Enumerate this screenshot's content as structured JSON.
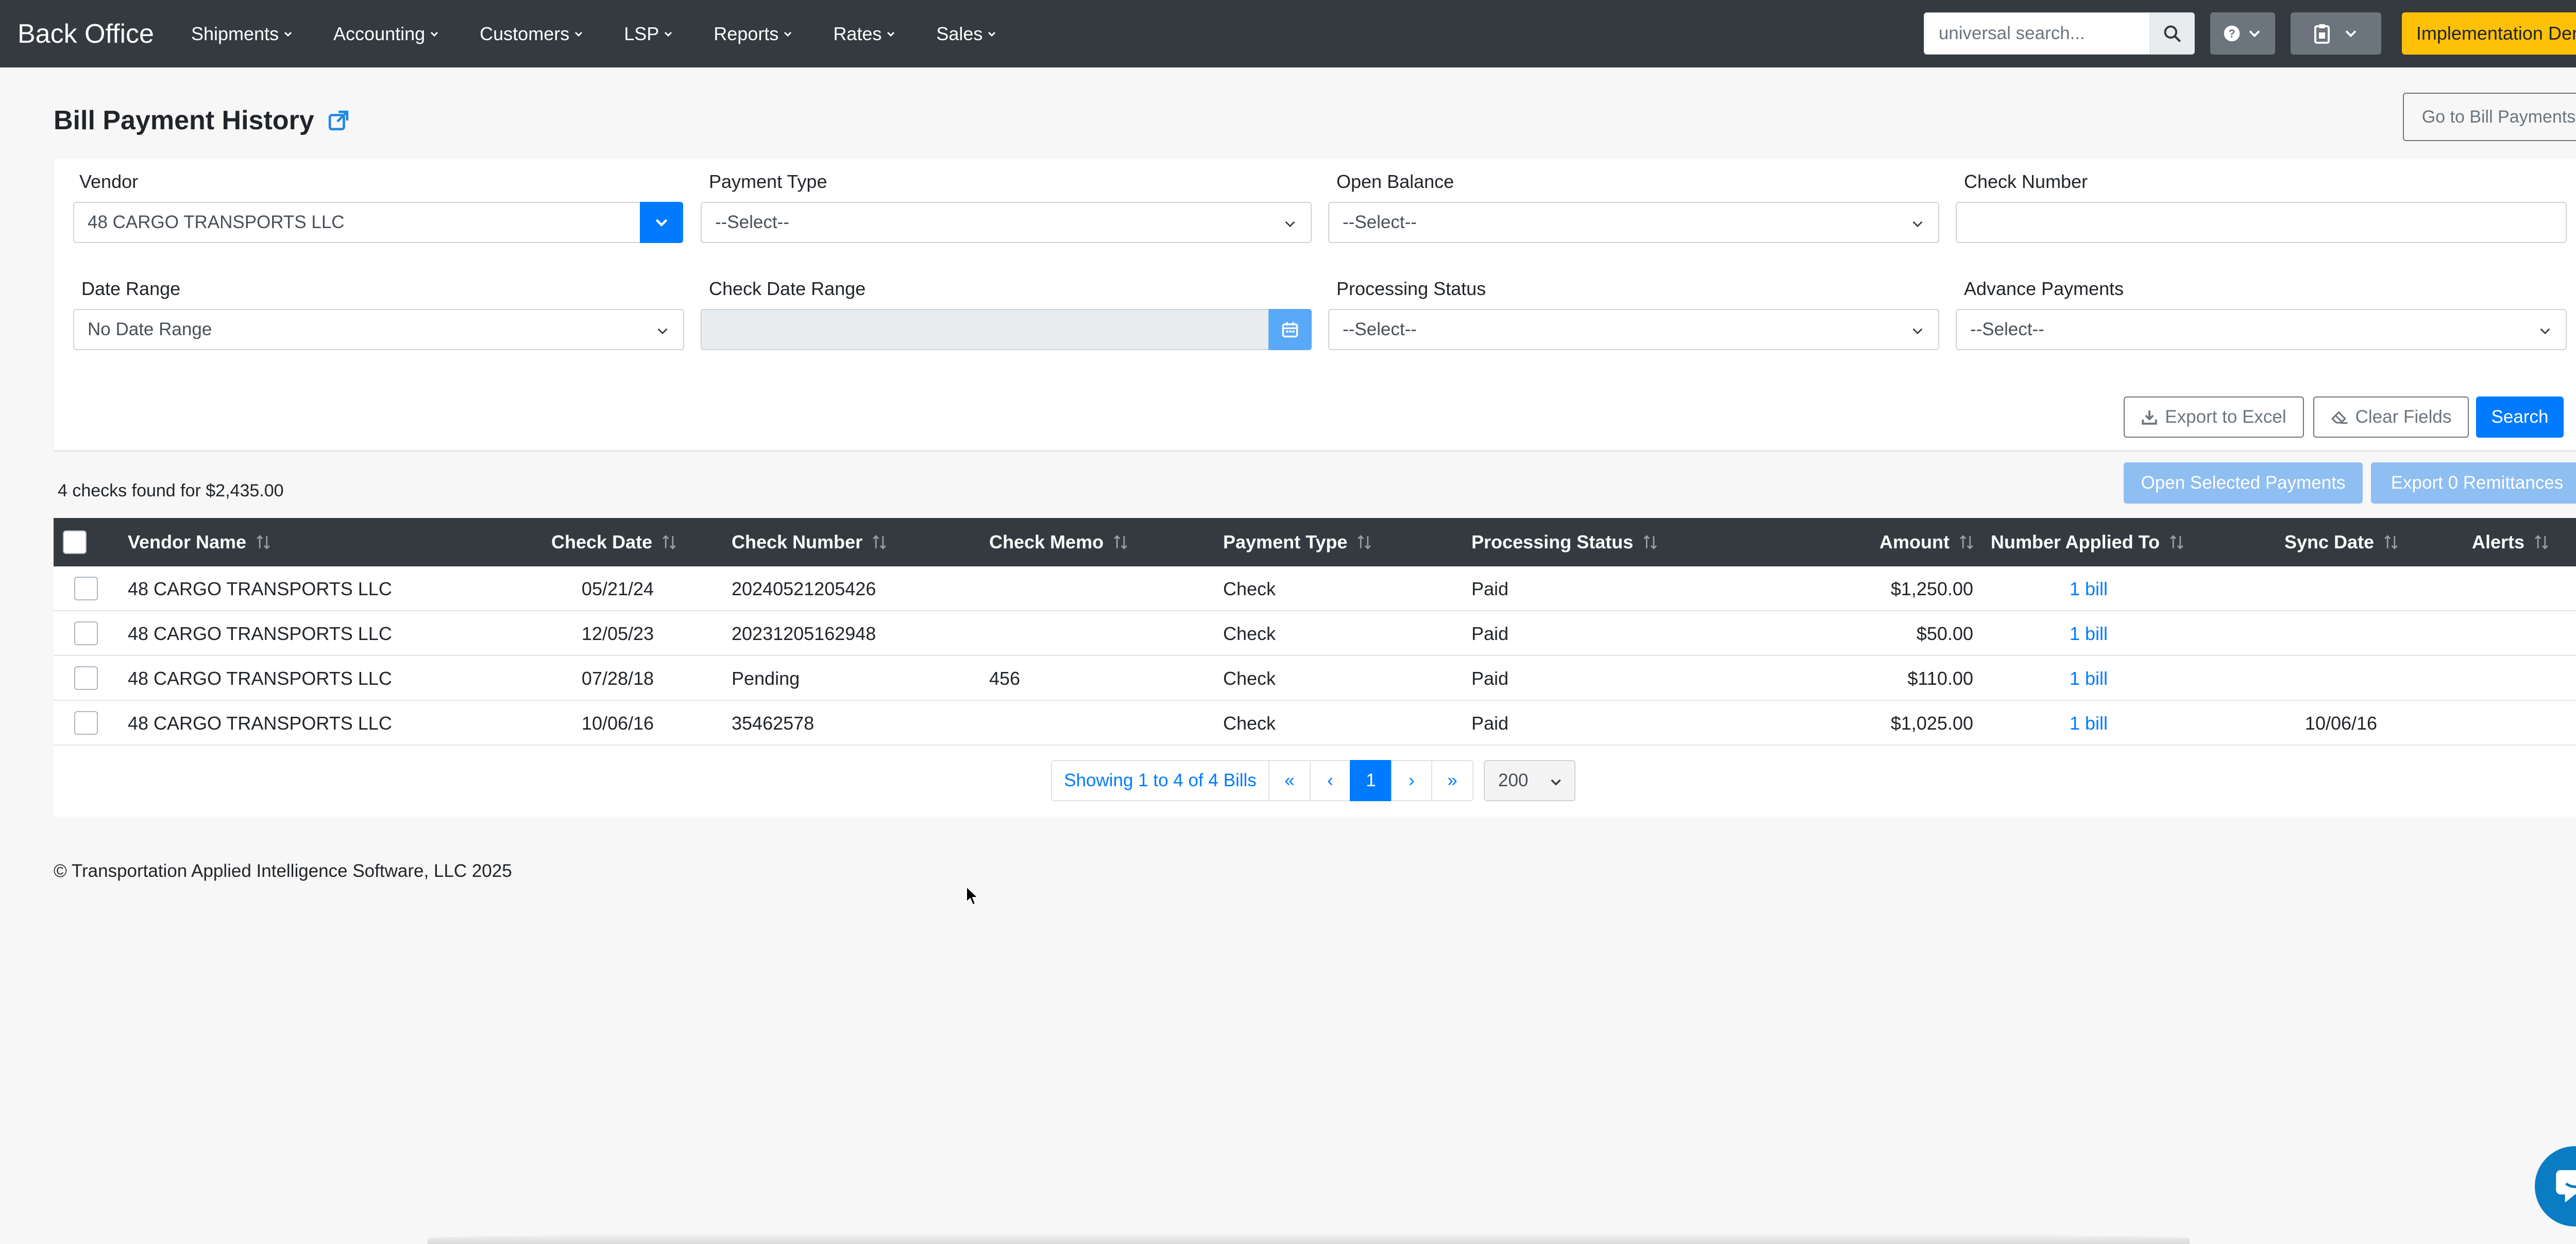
{
  "navbar": {
    "brand": "Back Office",
    "menu": [
      {
        "label": "Shipments"
      },
      {
        "label": "Accounting"
      },
      {
        "label": "Customers"
      },
      {
        "label": "LSP"
      },
      {
        "label": "Reports"
      },
      {
        "label": "Rates"
      },
      {
        "label": "Sales"
      }
    ],
    "search_placeholder": "universal search...",
    "org_button": "Implementation Demo",
    "icons": {
      "search": "search-icon",
      "help": "question-circle-icon",
      "clipboard": "clipboard-icon"
    }
  },
  "page": {
    "title": "Bill Payment History",
    "goto_button": "Go to Bill Payments"
  },
  "filters": {
    "vendor": {
      "label": "Vendor",
      "value": "48 CARGO TRANSPORTS LLC"
    },
    "payment_type": {
      "label": "Payment Type",
      "value": "--Select--"
    },
    "open_balance": {
      "label": "Open Balance",
      "value": "--Select--"
    },
    "check_number": {
      "label": "Check Number",
      "value": ""
    },
    "date_range": {
      "label": "Date Range",
      "value": "No Date Range"
    },
    "check_date_range": {
      "label": "Check Date Range",
      "value": ""
    },
    "processing_status": {
      "label": "Processing Status",
      "value": "--Select--"
    },
    "advance_payments": {
      "label": "Advance Payments",
      "value": "--Select--"
    },
    "export_excel": "Export to Excel",
    "clear_fields": "Clear Fields",
    "search": "Search"
  },
  "results": {
    "summary": "4 checks found for $2,435.00",
    "open_selected": "Open Selected Payments",
    "export_remittances": "Export 0 Remittances",
    "columns": [
      "Vendor Name",
      "Check Date",
      "Check Number",
      "Check Memo",
      "Payment Type",
      "Processing Status",
      "Amount",
      "Number Applied To",
      "Sync Date",
      "Alerts"
    ],
    "rows": [
      {
        "vendor": "48 CARGO TRANSPORTS LLC",
        "check_date": "05/21/24",
        "check_number": "20240521205426",
        "memo": "",
        "payment_type": "Check",
        "status": "Paid",
        "amount": "$1,250.00",
        "applied": "1 bill",
        "sync_date": "",
        "alerts": ""
      },
      {
        "vendor": "48 CARGO TRANSPORTS LLC",
        "check_date": "12/05/23",
        "check_number": "20231205162948",
        "memo": "",
        "payment_type": "Check",
        "status": "Paid",
        "amount": "$50.00",
        "applied": "1 bill",
        "sync_date": "",
        "alerts": ""
      },
      {
        "vendor": "48 CARGO TRANSPORTS LLC",
        "check_date": "07/28/18",
        "check_number": "Pending",
        "memo": "456",
        "payment_type": "Check",
        "status": "Paid",
        "amount": "$110.00",
        "applied": "1 bill",
        "sync_date": "",
        "alerts": ""
      },
      {
        "vendor": "48 CARGO TRANSPORTS LLC",
        "check_date": "10/06/16",
        "check_number": "35462578",
        "memo": "",
        "payment_type": "Check",
        "status": "Paid",
        "amount": "$1,025.00",
        "applied": "1 bill",
        "sync_date": "10/06/16",
        "alerts": ""
      }
    ]
  },
  "pagination": {
    "showing": "Showing 1 to 4 of 4 Bills",
    "first": "«",
    "prev": "‹",
    "current": "1",
    "next": "›",
    "last": "»",
    "per_page": "200"
  },
  "footer": "© Transportation Applied Intelligence Software, LLC 2025",
  "colors": {
    "navbar": "#343a40",
    "primary": "#007bff",
    "warning": "#ffc107",
    "chat": "#0a7cc4"
  }
}
